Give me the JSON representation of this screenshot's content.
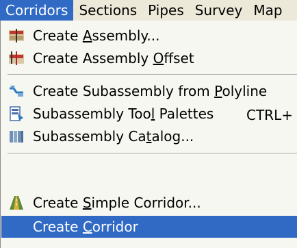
{
  "menubar": {
    "items": [
      "Corridors",
      "Sections",
      "Pipes",
      "Survey",
      "Map"
    ]
  },
  "menu": {
    "items": [
      {
        "pre": "Create ",
        "key": "A",
        "post": "ssembly...",
        "icon": "create-assembly-icon"
      },
      {
        "pre": "Create Assembly ",
        "key": "O",
        "post": "ffset",
        "icon": "assembly-offset-icon"
      },
      {
        "pre": "Create Subassembly from ",
        "key": "P",
        "post": "olyline",
        "icon": "subassembly-polyline-icon"
      },
      {
        "pre": "Subassembly Too",
        "key": "l",
        "post": " Palettes",
        "shortcut": "CTRL+",
        "icon": "tool-palettes-icon"
      },
      {
        "pre": "Subassembly Ca",
        "key": "t",
        "post": "alog...",
        "icon": "catalog-icon"
      },
      {
        "pre": "Create ",
        "key": "S",
        "post": "imple Corridor...",
        "icon": "simple-corridor-icon"
      },
      {
        "pre": "Create ",
        "key": "C",
        "post": "orridor",
        "icon": ""
      }
    ]
  },
  "colors": {
    "highlight": "#316ac5",
    "menu_bg": "#f7f7f2",
    "menubar_bg": "#ece9d8"
  }
}
